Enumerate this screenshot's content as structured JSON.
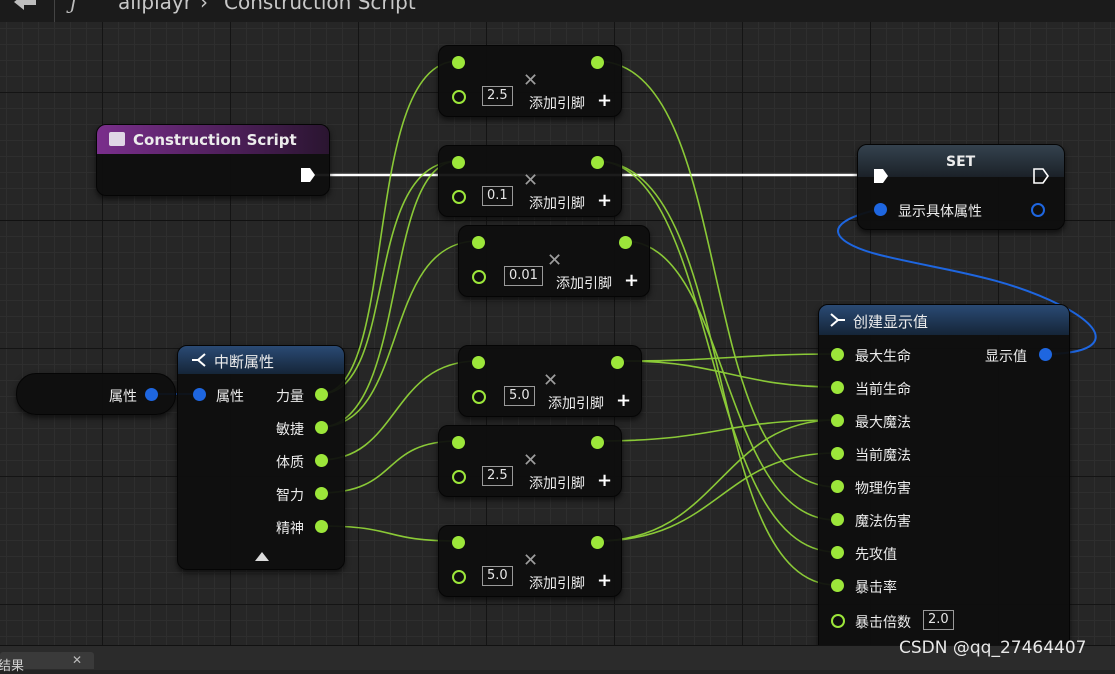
{
  "breadcrumb": {
    "asset": "allplayr",
    "separator": "›",
    "graph": "Construction Script"
  },
  "construction_node": {
    "title": "Construction Script"
  },
  "set_node": {
    "title": "SET",
    "input_label": "显示具体属性"
  },
  "break_node": {
    "title": "中断属性",
    "input_label": "属性",
    "outputs": [
      "力量",
      "敏捷",
      "体质",
      "智力",
      "精神"
    ]
  },
  "variable_node": {
    "label": "属性"
  },
  "multiply_nodes": [
    {
      "value": "2.5",
      "add_pin": "添加引脚"
    },
    {
      "value": "0.1",
      "add_pin": "添加引脚"
    },
    {
      "value": "0.01",
      "add_pin": "添加引脚"
    },
    {
      "value": "5.0",
      "add_pin": "添加引脚"
    },
    {
      "value": "2.5",
      "add_pin": "添加引脚"
    },
    {
      "value": "5.0",
      "add_pin": "添加引脚"
    }
  ],
  "make_node": {
    "title": "创建显示值",
    "output_label": "显示值",
    "inputs": [
      "最大生命",
      "当前生命",
      "最大魔法",
      "当前魔法",
      "物理伤害",
      "魔法伤害",
      "先攻值",
      "暴击率",
      "暴击倍数"
    ],
    "crit_multiplier_value": "2.0"
  },
  "bottom_tab": {
    "label": "结果"
  },
  "watermark": "CSDN @qq_27464407",
  "colors": {
    "float_pin": "#9ce63a",
    "struct_pin": "#1e66e0",
    "exec_wire": "#ffffff",
    "func_header": "#6a2a7a",
    "make_header": "#1d3f66"
  },
  "icons": [
    "function-icon",
    "play-icon",
    "struct-break-icon",
    "struct-make-icon",
    "multiply-icon",
    "plus-icon"
  ]
}
